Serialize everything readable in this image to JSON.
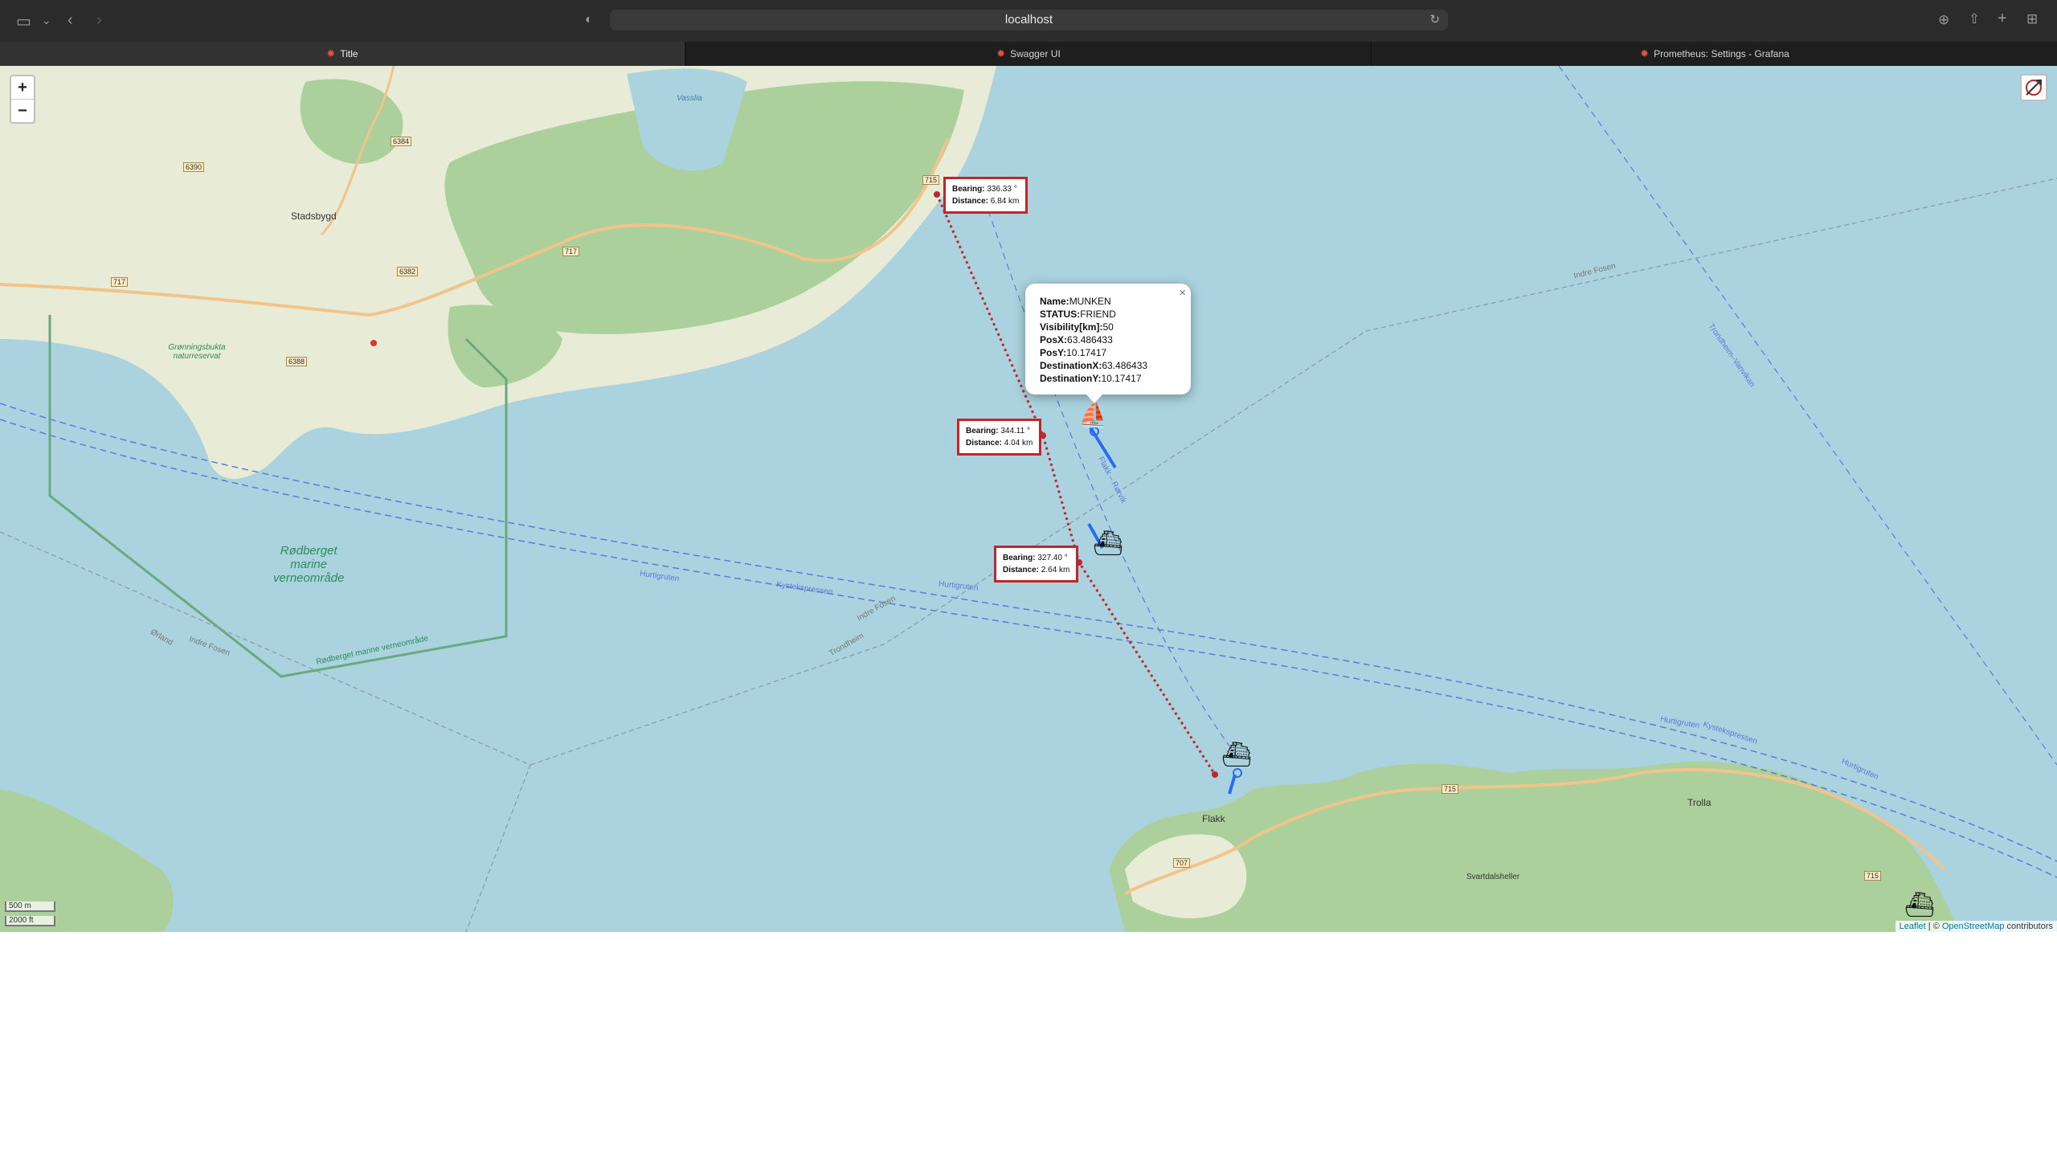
{
  "browser": {
    "url": "localhost",
    "tabs": [
      {
        "label": "Title",
        "active": true
      },
      {
        "label": "Swagger UI",
        "active": false
      },
      {
        "label": "Prometheus: Settings - Grafana",
        "active": false
      }
    ]
  },
  "map_controls": {
    "zoom_in": "+",
    "zoom_out": "−"
  },
  "measurements": [
    {
      "bearing_label": "Bearing:",
      "bearing": "336.33 °",
      "distance_label": "Distance:",
      "distance": "6.84 km"
    },
    {
      "bearing_label": "Bearing:",
      "bearing": "344.11 °",
      "distance_label": "Distance:",
      "distance": "4.04 km"
    },
    {
      "bearing_label": "Bearing:",
      "bearing": "327.40 °",
      "distance_label": "Distance:",
      "distance": "2.64 km"
    }
  ],
  "popup": {
    "close": "×",
    "rows": [
      {
        "label": "Name:",
        "value": "MUNKEN"
      },
      {
        "label": "STATUS:",
        "value": "FRIEND"
      },
      {
        "label": "Visibility[km]:",
        "value": "50"
      },
      {
        "label": "PosX:",
        "value": "63.486433"
      },
      {
        "label": "PosY:",
        "value": "10.17417"
      },
      {
        "label": "DestinationX:",
        "value": "63.486433"
      },
      {
        "label": "DestinationY:",
        "value": "10.17417"
      }
    ]
  },
  "map_labels": {
    "stadsbygd": "Stadsbygd",
    "flakk": "Flakk",
    "trolla": "Trolla",
    "svartdalsheller": "Svartdalsheller",
    "vasslia": "Vasslia",
    "reserve_name": "Rødberget marine verneområde",
    "reserve_line1": "Rødberget",
    "reserve_line2": "marine",
    "reserve_line3": "verneområde",
    "gronningsbukta": "Grønningsbukta naturreservat",
    "hurtigruten_1": "Hurtigruten",
    "hurtigruten_2": "Hurtigruten",
    "hurtigruten_3": "Hurtigruten",
    "hurtigruten_4": "Hurtigruten",
    "kystekspressen_1": "Kystekspressen",
    "kystekspressen_2": "Kystekspressen",
    "indre_fosen_1": "Indre Fosen",
    "indre_fosen_2": "Indre Fosen",
    "indre_fosen_3": "Indre Fosen",
    "trondheim_1": "Trondheim",
    "trondheim_2": "Trondheim–Vanvikan",
    "orland": "Ørland",
    "flakk_rorvik": "Flakk – Rørvik",
    "fv715": "715",
    "fv717": "717",
    "fv707": "707",
    "fv6384": "6384",
    "fv6390": "6390",
    "fv6382": "6382",
    "fv6388": "6388",
    "fv715b": "715",
    "fv715c": "715",
    "fv717b": "717"
  },
  "scale": {
    "metric": "500 m",
    "imperial": "2000 ft"
  },
  "attribution": {
    "leaflet": "Leaflet",
    "sep": " | © ",
    "osm": "OpenStreetMap",
    "suffix": " contributors"
  },
  "colors": {
    "land": "#dfe7d0",
    "forest": "#a8cf97",
    "water": "#aad3df",
    "road": "#f0c48a",
    "measure": "#c0272d",
    "route": "#2a6cf0"
  }
}
